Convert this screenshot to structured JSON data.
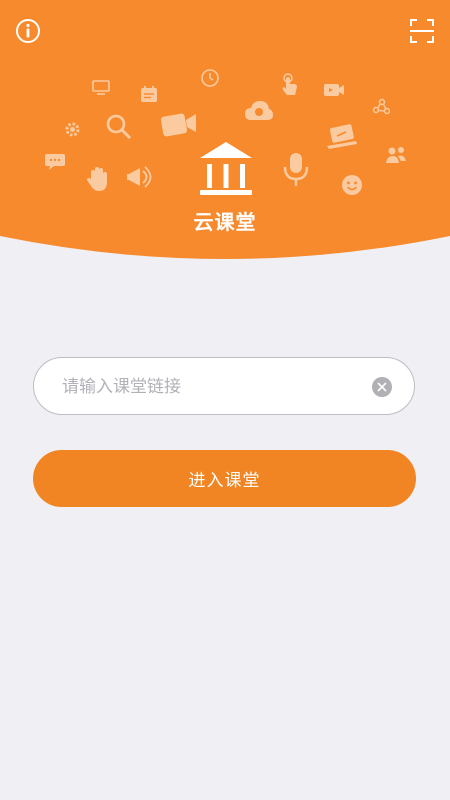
{
  "app": {
    "title": "云课堂"
  },
  "link_input": {
    "placeholder": "请输入课堂链接",
    "value": ""
  },
  "enter_button": {
    "label": "进入课堂"
  },
  "icons": {
    "info": "info-icon",
    "scan": "scan-icon",
    "logo": "classroom-building-icon",
    "clear": "clear-icon"
  },
  "colors": {
    "header_orange": "#f68a2d",
    "button_orange": "#f28523",
    "page_background": "#efeff4",
    "input_border": "#bdbdc3"
  }
}
